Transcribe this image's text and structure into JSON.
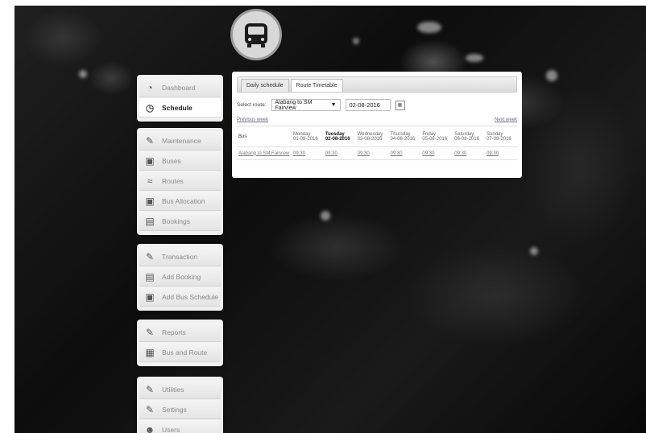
{
  "sidebar": {
    "group1": [
      {
        "label": "Dashboard",
        "icon": "dashboard-icon",
        "active": false
      },
      {
        "label": "Schedule",
        "icon": "clock-icon",
        "active": true
      }
    ],
    "group2": [
      {
        "label": "Maintenance",
        "icon": "wrench-icon"
      },
      {
        "label": "Buses",
        "icon": "bus-icon"
      },
      {
        "label": "Routes",
        "icon": "route-icon"
      },
      {
        "label": "Bus Allocation",
        "icon": "bus-icon"
      },
      {
        "label": "Bookings",
        "icon": "clipboard-icon"
      }
    ],
    "group3": [
      {
        "label": "Transaction",
        "icon": "wrench-icon"
      },
      {
        "label": "Add Booking",
        "icon": "clipboard-icon"
      },
      {
        "label": "Add Bus Schedule",
        "icon": "bus-icon"
      }
    ],
    "group4": [
      {
        "label": "Reports",
        "icon": "wrench-icon"
      },
      {
        "label": "Bus and Route",
        "icon": "chart-icon"
      }
    ],
    "group5": [
      {
        "label": "Utilities",
        "icon": "wrench-icon"
      },
      {
        "label": "Settings",
        "icon": "wrench-icon"
      },
      {
        "label": "Users",
        "icon": "users-icon"
      }
    ]
  },
  "tabs": {
    "daily": "Daily schedule",
    "route": "Route Timetable"
  },
  "route_select": {
    "label": "Select route:",
    "value": "Alabang to SM Fairview",
    "arrow": "▼"
  },
  "date_input": {
    "value": "02-08-2016"
  },
  "week_nav": {
    "prev": "Previous week",
    "next": "Next week"
  },
  "table": {
    "bus_header": "Bus",
    "days": [
      {
        "day": "Monday",
        "date": "01-08-2016",
        "today": false
      },
      {
        "day": "Tuesday",
        "date": "02-08-2016",
        "today": true
      },
      {
        "day": "Wednesday",
        "date": "03-08-2016",
        "today": false
      },
      {
        "day": "Thursday",
        "date": "04-08-2016",
        "today": false
      },
      {
        "day": "Friday",
        "date": "05-08-2016",
        "today": false
      },
      {
        "day": "Saturday",
        "date": "06-08-2016",
        "today": false
      },
      {
        "day": "Sunday",
        "date": "07-08-2016",
        "today": false
      }
    ],
    "rows": [
      {
        "route": "Alabang to SM Fairview",
        "times": [
          "09:30",
          "09:30",
          "09:30",
          "09:30",
          "09:30",
          "09:30",
          "09:30"
        ]
      }
    ]
  }
}
